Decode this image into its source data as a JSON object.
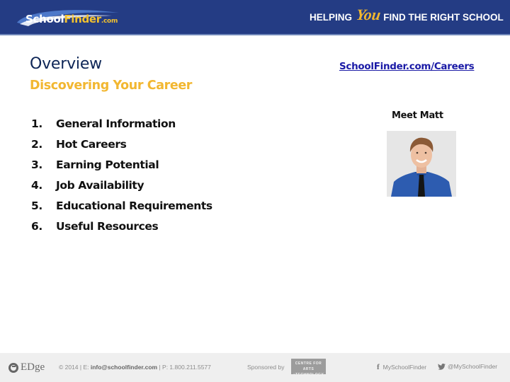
{
  "header": {
    "logo": {
      "school": "School",
      "finder": "Finder",
      "com": ".com"
    },
    "tagline": {
      "before": "HELPING",
      "you": "You",
      "after": "FIND THE RIGHT SCHOOL"
    }
  },
  "main": {
    "title": "Overview",
    "subtitle": "Discovering Your Career",
    "items": [
      {
        "num": "1.",
        "label": "General Information"
      },
      {
        "num": "2.",
        "label": "Hot Careers"
      },
      {
        "num": "3.",
        "label": "Earning Potential"
      },
      {
        "num": "4.",
        "label": "Job Availability"
      },
      {
        "num": "5.",
        "label": "Educational Requirements"
      },
      {
        "num": "6.",
        "label": "Useful Resources"
      }
    ],
    "link": "SchoolFinder.com/Careers",
    "meet_label": "Meet Matt",
    "photo_alt": "Photo of Matt"
  },
  "footer": {
    "edge": "EDge",
    "copyright": "© 2014 | E: ",
    "email": "info@schoolfinder.com",
    "phone": " | P: 1.800.211.5577",
    "sponsored_by": "Sponsored by",
    "sponsor_line1": "CENTRE FOR ARTS",
    "sponsor_line2": "+TECHNOLOGY",
    "facebook_icon": "f",
    "facebook": "MySchoolFinder",
    "twitter": "@MySchoolFinder"
  },
  "colors": {
    "header_bg": "#243c84",
    "accent_gold": "#f2b731",
    "title_navy": "#0d2556",
    "link_blue": "#1a1aa6"
  }
}
